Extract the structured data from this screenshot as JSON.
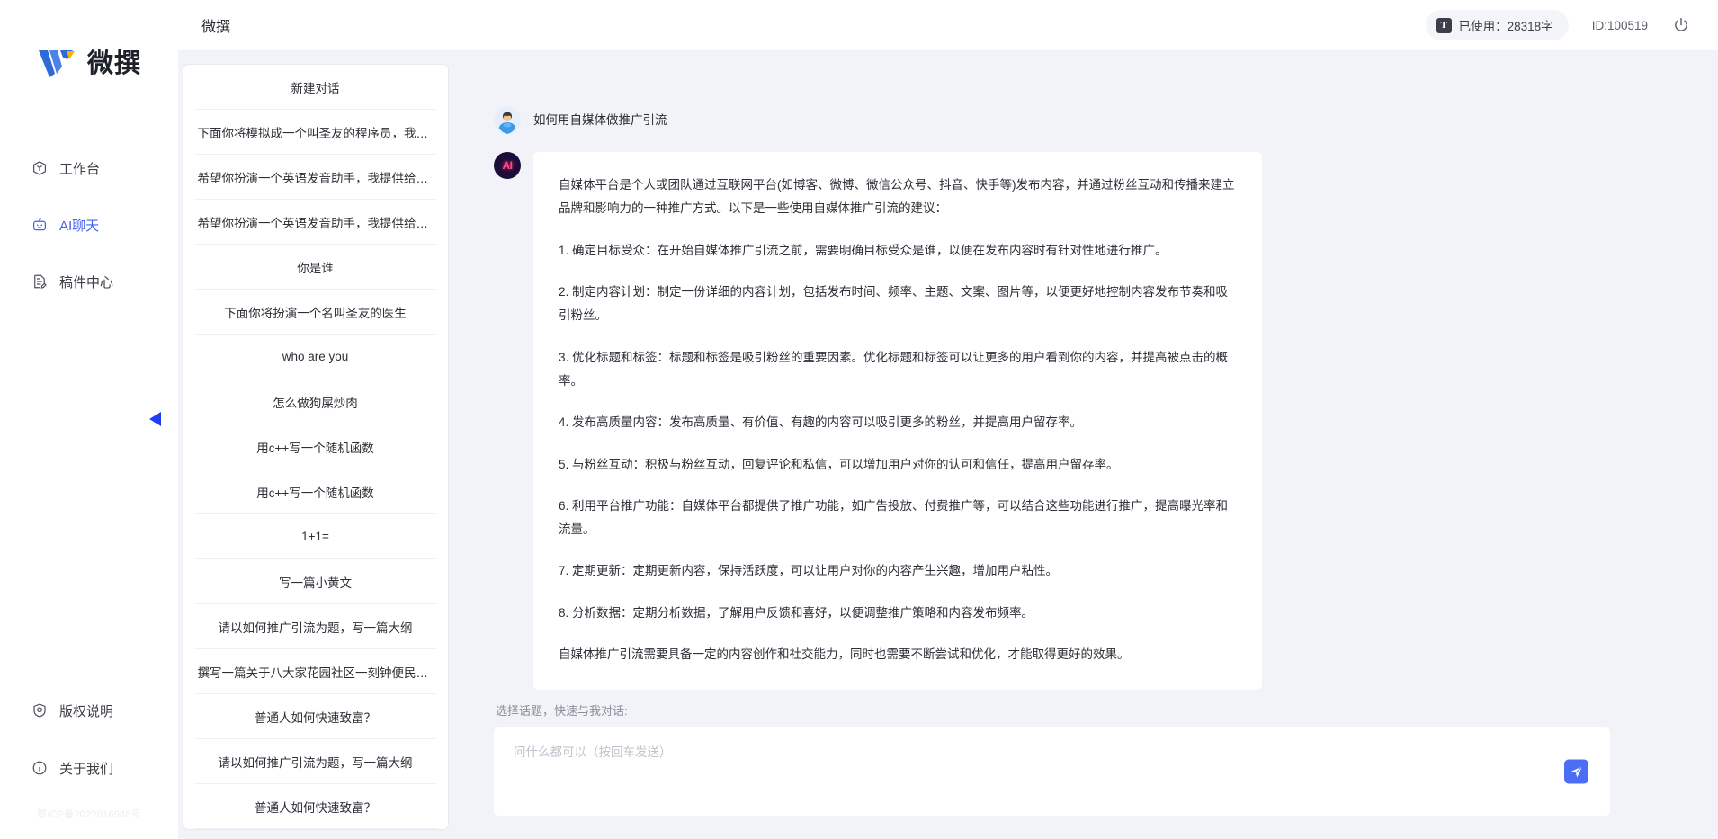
{
  "brand": {
    "logo_text": "微撰",
    "logo_icon": "w-logo-icon"
  },
  "sidebar": {
    "items": [
      {
        "label": "工作台",
        "icon": "workbench-icon",
        "active": false
      },
      {
        "label": "AI聊天",
        "icon": "ai-chat-icon",
        "active": true
      },
      {
        "label": "稿件中心",
        "icon": "documents-icon",
        "active": false
      }
    ],
    "bottom_items": [
      {
        "label": "版权说明",
        "icon": "shield-icon"
      },
      {
        "label": "关于我们",
        "icon": "info-icon"
      }
    ],
    "icp": "鄂ICP备2022016946号",
    "collapse_icon": "chevron-left-icon"
  },
  "topbar": {
    "title": "微撰",
    "usage_label": "已使用：28318字",
    "usage_icon": "text-count-icon",
    "user_id": "ID:100519",
    "power_icon": "power-icon"
  },
  "conversations": {
    "new_chat_label": "新建对话",
    "items": [
      "下面你将模拟成一个叫圣友的程序员，我说...",
      "希望你扮演一个英语发音助手，我提供给你...",
      "希望你扮演一个英语发音助手，我提供给你...",
      "你是谁",
      "下面你将扮演一个名叫圣友的医生",
      "who are you",
      "怎么做狗屎炒肉",
      "用c++写一个随机函数",
      "用c++写一个随机函数",
      "1+1=",
      "写一篇小黄文",
      "请以如何推广引流为题，写一篇大纲",
      "撰写一篇关于八大家花园社区一刻钟便民生...",
      "普通人如何快速致富？",
      "请以如何推广引流为题，写一篇大纲",
      "普通人如何快速致富？"
    ]
  },
  "chat": {
    "user_avatar_icon": "user-avatar-icon",
    "ai_avatar_label": "AI",
    "user_message": "如何用自媒体做推广引流",
    "ai_paragraphs": [
      "自媒体平台是个人或团队通过互联网平台(如博客、微博、微信公众号、抖音、快手等)发布内容，并通过粉丝互动和传播来建立品牌和影响力的一种推广方式。以下是一些使用自媒体推广引流的建议：",
      "1. 确定目标受众：在开始自媒体推广引流之前，需要明确目标受众是谁，以便在发布内容时有针对性地进行推广。",
      "2. 制定内容计划：制定一份详细的内容计划，包括发布时间、频率、主题、文案、图片等，以便更好地控制内容发布节奏和吸引粉丝。",
      "3. 优化标题和标签：标题和标签是吸引粉丝的重要因素。优化标题和标签可以让更多的用户看到你的内容，并提高被点击的概率。",
      "4. 发布高质量内容：发布高质量、有价值、有趣的内容可以吸引更多的粉丝，并提高用户留存率。",
      "5. 与粉丝互动：积极与粉丝互动，回复评论和私信，可以增加用户对你的认可和信任，提高用户留存率。",
      "6. 利用平台推广功能：自媒体平台都提供了推广功能，如广告投放、付费推广等，可以结合这些功能进行推广，提高曝光率和流量。",
      "7. 定期更新：定期更新内容，保持活跃度，可以让用户对你的内容产生兴趣，增加用户粘性。",
      "8. 分析数据：定期分析数据，了解用户反馈和喜好，以便调整推广策略和内容发布频率。",
      "自媒体推广引流需要具备一定的内容创作和社交能力，同时也需要不断尝试和优化，才能取得更好的效果。"
    ]
  },
  "composer": {
    "topic_hint": "选择话题，快速与我对话:",
    "placeholder": "问什么都可以（按回车发送）",
    "send_icon": "send-icon",
    "accent_color": "#4c6ef5"
  }
}
